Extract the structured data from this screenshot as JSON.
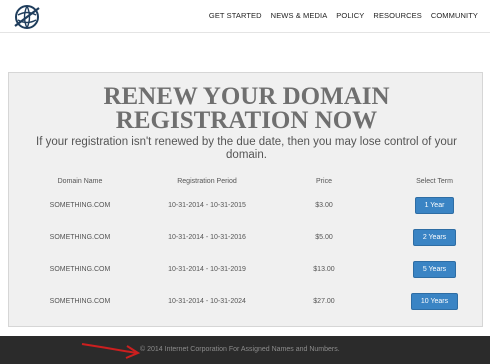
{
  "nav": {
    "items": [
      "GET STARTED",
      "NEWS & MEDIA",
      "POLICY",
      "RESOURCES",
      "COMMUNITY"
    ]
  },
  "panel": {
    "title": "RENEW YOUR DOMAIN REGISTRATION NOW",
    "subtitle": "If your registration isn't renewed by the due date, then you may lose control of your domain."
  },
  "table": {
    "headers": [
      "Domain Name",
      "Registration Period",
      "Price",
      "Select Term"
    ],
    "rows": [
      {
        "domain": "SOMETHING.COM",
        "period": "10-31-2014 - 10-31-2015",
        "price": "$3.00",
        "term": "1 Year"
      },
      {
        "domain": "SOMETHING.COM",
        "period": "10-31-2014 - 10-31-2016",
        "price": "$5.00",
        "term": "2 Years"
      },
      {
        "domain": "SOMETHING.COM",
        "period": "10-31-2014 - 10-31-2019",
        "price": "$13.00",
        "term": "5 Years"
      },
      {
        "domain": "SOMETHING.COM",
        "period": "10-31-2014 - 10-31-2024",
        "price": "$27.00",
        "term": "10 Years"
      }
    ]
  },
  "footer": {
    "copyright": "© 2014 Internet Corporation For Assigned Names and Numbers."
  },
  "colors": {
    "button": "#3a84c4",
    "footer_bg": "#2b2b2b",
    "arrow": "#cc1f1f"
  },
  "icons": {
    "logo": "globe-logo-icon",
    "annotation": "red-arrow-icon"
  }
}
